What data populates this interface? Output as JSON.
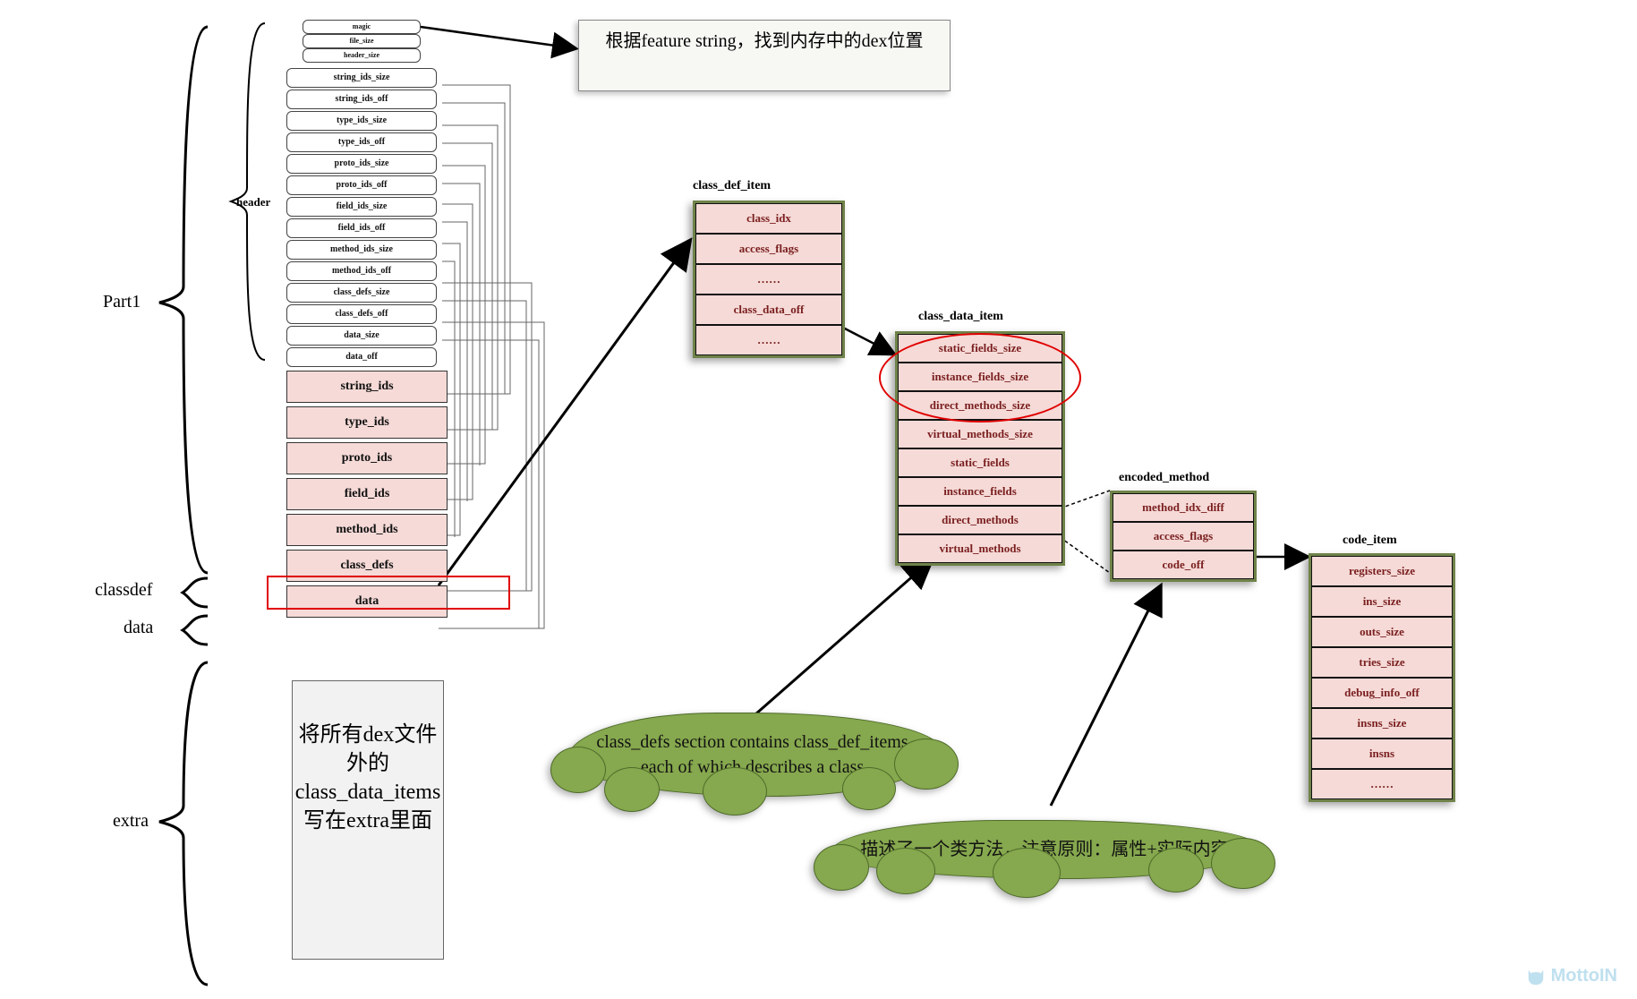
{
  "labels": {
    "part1": "Part1",
    "classdef": "classdef",
    "data": "data",
    "extra": "extra",
    "header": "header"
  },
  "header_rows_tiny": [
    "magic",
    "file_size",
    "header_size"
  ],
  "header_rows": [
    "string_ids_size",
    "string_ids_off",
    "type_ids_size",
    "type_ids_off",
    "proto_ids_size",
    "proto_ids_off",
    "field_ids_size",
    "field_ids_off",
    "method_ids_size",
    "method_ids_off",
    "class_defs_size",
    "class_defs_off",
    "data_size",
    "data_off"
  ],
  "body_rows": [
    "string_ids",
    "type_ids",
    "proto_ids",
    "field_ids",
    "method_ids",
    "class_defs",
    "data"
  ],
  "extra_box_text": "将所有dex文件外的class_data_items写在extra里面",
  "callout_top": "根据feature string，找到内存中的dex位置",
  "tables": {
    "class_def_item": {
      "title": "class_def_item",
      "rows": [
        "class_idx",
        "access_flags",
        "……",
        "class_data_off",
        "……"
      ]
    },
    "class_data_item": {
      "title": "class_data_item",
      "rows": [
        "static_fields_size",
        "instance_fields_size",
        "direct_methods_size",
        "virtual_methods_size",
        "static_fields",
        "instance_fields",
        "direct_methods",
        "virtual_methods"
      ]
    },
    "encoded_method": {
      "title": "encoded_method",
      "rows": [
        "method_idx_diff",
        "access_flags",
        "code_off"
      ]
    },
    "code_item": {
      "title": "code_item",
      "rows": [
        "registers_size",
        "ins_size",
        "outs_size",
        "tries_size",
        "debug_info_off",
        "insns_size",
        "insns",
        "……"
      ]
    }
  },
  "clouds": {
    "defs": "class_defs section contains class_def_items, each of which describes a class.",
    "method": "描述了一个类方法，注意原则：属性+实际内容"
  },
  "watermark": "MottoIN"
}
